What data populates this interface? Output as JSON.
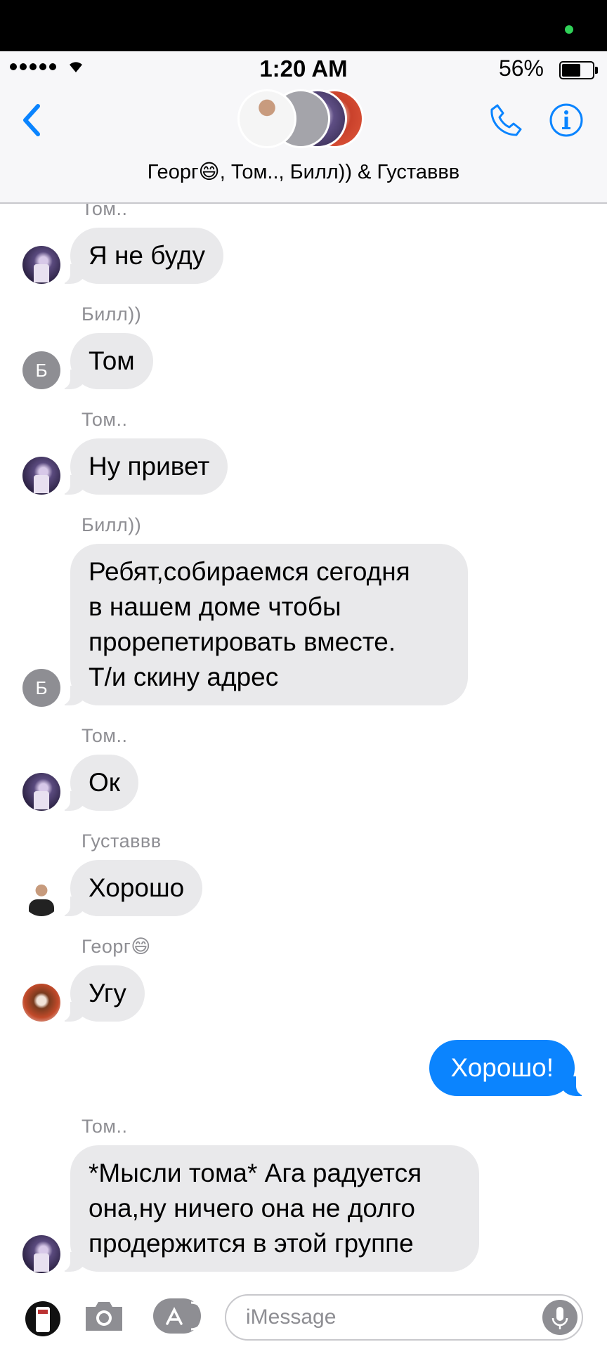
{
  "status_bar": {
    "time": "1:20 AM",
    "battery_percent": "56%",
    "battery_level": 0.56
  },
  "header": {
    "title": "Георг😄, Том.., Билл)) & Густаввв",
    "back_icon": "chevron-left-icon",
    "call_icon": "phone-icon",
    "info_icon": "info-icon"
  },
  "messages": [
    {
      "sender": "Том..",
      "text": "Я не буду"
    },
    {
      "sender": "Билл))",
      "avatar_letter": "Б",
      "text": "Том"
    },
    {
      "sender": "Том..",
      "text": "Ну привет"
    },
    {
      "sender": "Билл))",
      "avatar_letter": "Б",
      "text": "Ребят,собираемся сегодня\nв нашем доме чтобы\nпрорепетировать вместе.\nТ/и скину адрес"
    },
    {
      "sender": "Том..",
      "text": "Ок"
    },
    {
      "sender": "Густаввв",
      "text": "Хорошо"
    },
    {
      "sender": "Георг😄",
      "text": "Угу"
    },
    {
      "sender": "",
      "text": "Хорошо!",
      "outgoing": true
    },
    {
      "sender": "Том..",
      "text": "*Мысли тома* Ага радуется\nона,ну ничего она не долго\nпродержится в этой группе"
    }
  ],
  "input_bar": {
    "placeholder": "iMessage",
    "camera_icon": "camera-icon",
    "appstore_icon": "app-store-icon",
    "mic_icon": "microphone-icon"
  },
  "colors": {
    "outgoing_bubble": "#0b84fe",
    "incoming_bubble": "#e9e9eb",
    "accent": "#0a84ff"
  }
}
